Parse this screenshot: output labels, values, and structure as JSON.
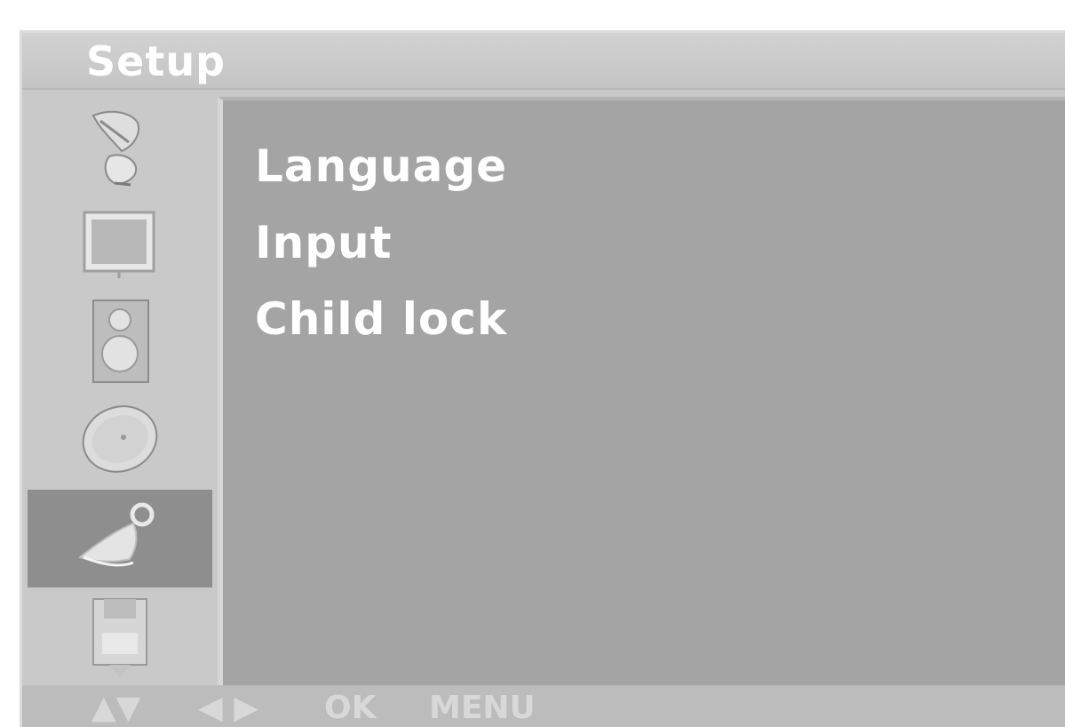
{
  "title": "Setup",
  "sidebar": {
    "items": [
      {
        "icon": "satellite-dish-icon",
        "selected": false
      },
      {
        "icon": "tv-picture-icon",
        "selected": false
      },
      {
        "icon": "speaker-icon",
        "selected": false
      },
      {
        "icon": "clock-icon",
        "selected": false
      },
      {
        "icon": "setup-wrench-icon",
        "selected": true
      },
      {
        "icon": "disk-icon",
        "selected": false
      }
    ]
  },
  "menu": {
    "items": [
      {
        "label": "Language"
      },
      {
        "label": "Input"
      },
      {
        "label": "Child lock"
      }
    ]
  },
  "bottom_bar": {
    "updown": "▲▼",
    "leftright": "◀ ▶",
    "ok": "OK",
    "menu": "MENU"
  },
  "colors": {
    "panel": "#c8c8c8",
    "content": "#a4a4a4",
    "selected": "#8e8e8e",
    "text": "#ffffff"
  }
}
